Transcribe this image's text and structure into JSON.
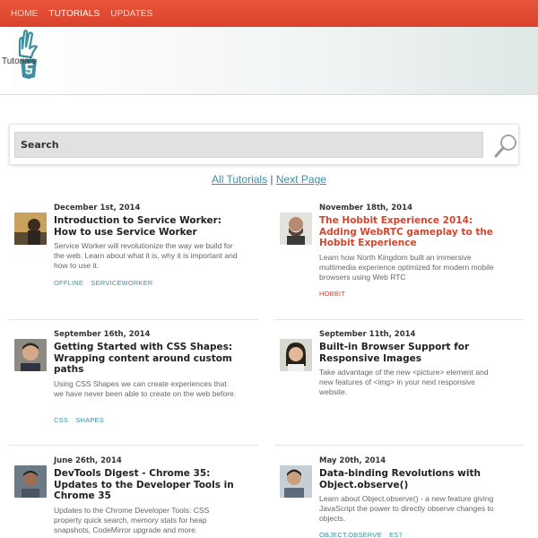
{
  "nav": {
    "items": [
      {
        "label": "HOME",
        "active": false
      },
      {
        "label": "TUTORIALS",
        "active": true
      },
      {
        "label": "UPDATES",
        "active": false
      }
    ]
  },
  "logo": {
    "text": "Tutorials",
    "icon": "html5-hand-icon"
  },
  "search": {
    "placeholder": "Search",
    "icon": "magnifier-icon"
  },
  "pager": {
    "all_label": "All Tutorials",
    "separator": "|",
    "next_label": "Next Page"
  },
  "colors": {
    "nav": "#d9432b",
    "link": "#3a8fa8",
    "tag_red": "#d3452e"
  },
  "articles": [
    {
      "date": "December 1st, 2014",
      "title": "Introduction to Service Worker: How to use Service Worker",
      "desc": "Service Worker will revolutionize the way we build for the web. Learn about what it is, why it is important and how to use it.",
      "tags": [
        "OFFLINE",
        "SERVICEWORKER"
      ]
    },
    {
      "date": "November 18th, 2014",
      "title": "The Hobbit Experience 2014: Adding WebRTC gameplay to the Hobbit Experience",
      "desc": "Learn how North Kingdom built an immersive multimedia experience optimized for modern mobile browsers using Web RTC",
      "tags": [
        "HOBBIT"
      ]
    },
    {
      "date": "September 16th, 2014",
      "title": "Getting Started with CSS Shapes: Wrapping content around custom paths",
      "desc": "Using CSS Shapes we can create experiences that we have never been able to create on the web before.",
      "tags": [
        "CSS",
        "SHAPES"
      ]
    },
    {
      "date": "September 11th, 2014",
      "title": "Built-in Browser Support for Responsive Images",
      "desc": "Take advantage of the new <picture> element and new features of <img> in your next responsive website.",
      "tags": []
    },
    {
      "date": "June 26th, 2014",
      "title": "DevTools Digest - Chrome 35: Updates to the Developer Tools in Chrome 35",
      "desc": "Updates to the Chrome Developer Tools: CSS property quick search, memory stats for heap snapshots, CodeMirror upgrade and more.",
      "tags": []
    },
    {
      "date": "May 20th, 2014",
      "title": "Data-binding Revolutions with Object.observe()",
      "desc": "Learn about Object.observe() - a new feature giving JavaScript the power to directly observe changes to objects.",
      "tags": [
        "OBJECT.OBSERVE",
        "ES7"
      ]
    }
  ]
}
